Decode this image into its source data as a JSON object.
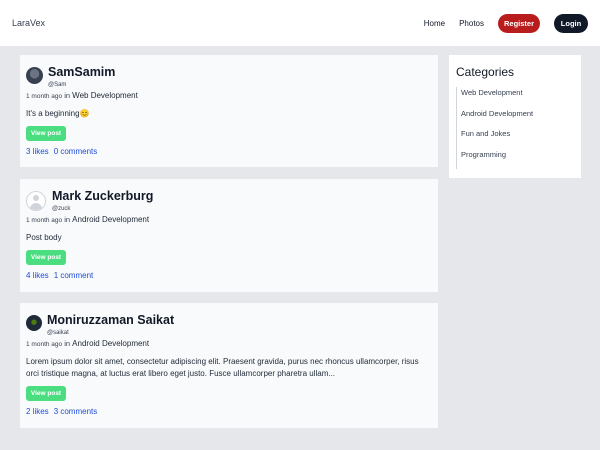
{
  "nav": {
    "brand": "LaraVex",
    "home": "Home",
    "photos": "Photos",
    "register": "Register",
    "login": "Login"
  },
  "posts": [
    {
      "name": "SamSamim",
      "handle": "@Sam",
      "time": "1 month ago",
      "in_word": "in",
      "category": "Web Development",
      "body": "It's a beginning😊",
      "view_label": "View post",
      "likes": "3 likes",
      "comments": "0 comments"
    },
    {
      "name": "Mark Zuckerburg",
      "handle": "@zuck",
      "time": "1 month ago",
      "in_word": "in",
      "category": "Android Development",
      "body": "Post body",
      "view_label": "View post",
      "likes": "4 likes",
      "comments": "1 comment"
    },
    {
      "name": "Moniruzzaman Saikat",
      "handle": "@saikat",
      "time": "1 month ago",
      "in_word": "in",
      "category": "Android Development",
      "body": "Lorem ipsum dolor sit amet, consectetur adipiscing elit. Praesent gravida, purus nec rhoncus ullamcorper, risus orci tristique magna, at luctus erat libero eget justo. Fusce ullamcorper pharetra ullam...",
      "view_label": "View post",
      "likes": "2 likes",
      "comments": "3 comments"
    }
  ],
  "sidebar": {
    "title": "Categories",
    "items": [
      "Web Development",
      "Android Development",
      "Fun and Jokes",
      "Programming"
    ]
  }
}
